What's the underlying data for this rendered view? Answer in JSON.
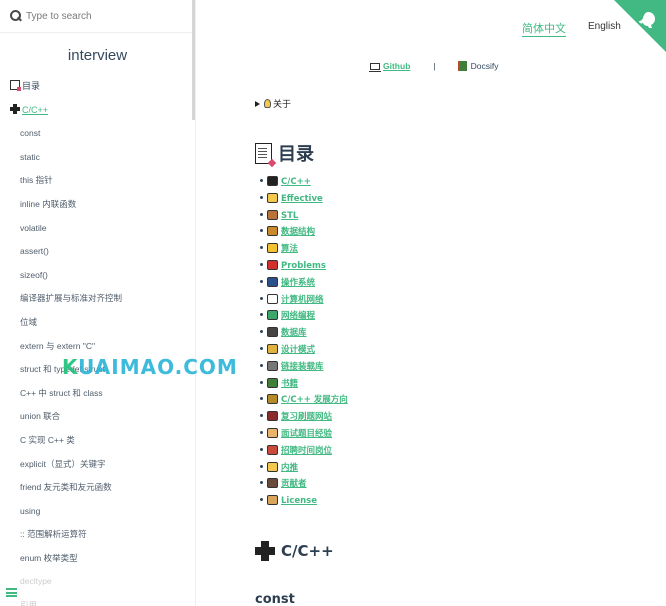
{
  "search": {
    "placeholder": "Type to search"
  },
  "sidebar": {
    "app_name": "interview",
    "items": [
      {
        "label": "目录",
        "level": "top",
        "icon": "memo-icon"
      },
      {
        "label": "C/C++",
        "level": "top",
        "icon": "heavy-plus-icon",
        "active": true
      },
      {
        "label": "const",
        "level": "sub"
      },
      {
        "label": "static",
        "level": "sub"
      },
      {
        "label": "this 指针",
        "level": "sub"
      },
      {
        "label": "inline 内联函数",
        "level": "sub"
      },
      {
        "label": "volatile",
        "level": "sub"
      },
      {
        "label": "assert()",
        "level": "sub"
      },
      {
        "label": "sizeof()",
        "level": "sub"
      },
      {
        "label": "编译器扩展与标准对齐控制",
        "level": "sub"
      },
      {
        "label": "位域",
        "level": "sub"
      },
      {
        "label": "extern 与 extern \"C\"",
        "level": "sub"
      },
      {
        "label": "struct 和 typedef struct",
        "level": "sub"
      },
      {
        "label": "C++ 中 struct 和 class",
        "level": "sub"
      },
      {
        "label": "union 联合",
        "level": "sub"
      },
      {
        "label": "C 实现 C++ 类",
        "level": "sub"
      },
      {
        "label": "explicit（显式）关键字",
        "level": "sub"
      },
      {
        "label": "friend 友元类和友元函数",
        "level": "sub"
      },
      {
        "label": "using",
        "level": "sub"
      },
      {
        "label": ":: 范围解析运算符",
        "level": "sub"
      },
      {
        "label": "enum 枚举类型",
        "level": "sub"
      },
      {
        "label": "decltype",
        "level": "sub"
      },
      {
        "label": "引用",
        "level": "sub"
      }
    ]
  },
  "header": {
    "lang_active": "简体中文",
    "lang_other": "English",
    "link_github": "Github",
    "separator": "|",
    "link_docsify": "Docsify"
  },
  "content": {
    "about": "关于",
    "toc_title": "目录",
    "toc": [
      {
        "label": "C/C++",
        "icon": "heavy-plus-icon",
        "color": "#222222"
      },
      {
        "label": "Effective",
        "icon": "star-icon",
        "color": "#f2c94c"
      },
      {
        "label": "STL",
        "icon": "books-icon",
        "color": "#b8733a"
      },
      {
        "label": "数据结构",
        "icon": "crown-icon",
        "color": "#c98a2b"
      },
      {
        "label": "算法",
        "icon": "zap-icon",
        "color": "#f2c230"
      },
      {
        "label": "Problems",
        "icon": "question-icon",
        "color": "#d0312d"
      },
      {
        "label": "操作系统",
        "icon": "laptop-icon",
        "color": "#2b4f8a"
      },
      {
        "label": "计算机网络",
        "icon": "cloud-icon",
        "color": "#ffffff"
      },
      {
        "label": "网络编程",
        "icon": "umbrella-icon",
        "color": "#3aa86b"
      },
      {
        "label": "数据库",
        "icon": "floppy-icon",
        "color": "#444444"
      },
      {
        "label": "设计模式",
        "icon": "pencil-icon",
        "color": "#e2b33c"
      },
      {
        "label": "链接装载库",
        "icon": "gear-icon",
        "color": "#777777"
      },
      {
        "label": "书籍",
        "icon": "book-icon",
        "color": "#3f7f3a"
      },
      {
        "label": "C/C++ 发展方向",
        "icon": "trophy-icon",
        "color": "#b58b2a"
      },
      {
        "label": "复习刷题网站",
        "icon": "bug-icon",
        "color": "#8a2a2a"
      },
      {
        "label": "面试题目经验",
        "icon": "memo-icon",
        "color": "#e8b36a"
      },
      {
        "label": "招聘时间岗位",
        "icon": "calendar-icon",
        "color": "#c94a3a"
      },
      {
        "label": "内推",
        "icon": "thumbs-up-icon",
        "color": "#f2c94c"
      },
      {
        "label": "贡献者",
        "icon": "family-icon",
        "color": "#6a4a3a"
      },
      {
        "label": "License",
        "icon": "scroll-icon",
        "color": "#d9a55a"
      }
    ],
    "section_title": "C/C++",
    "subsection_title": "const"
  },
  "watermark": {
    "prefix": "K",
    "text": "UAIMAO.COM"
  },
  "colors": {
    "accent": "#42b983",
    "text": "#34495e",
    "heading": "#2c3e50"
  }
}
